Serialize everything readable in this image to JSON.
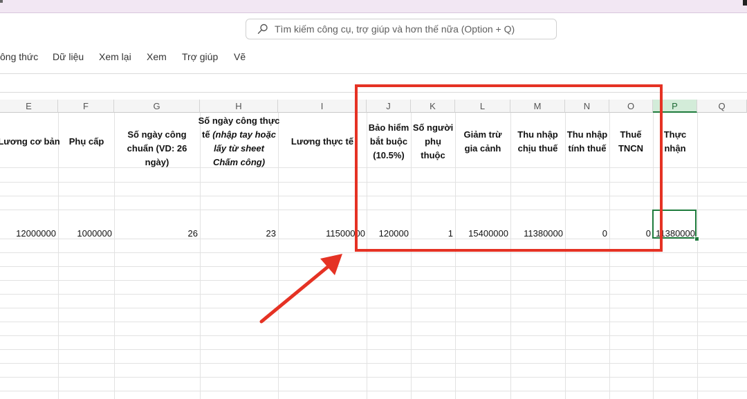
{
  "search": {
    "placeholder": "Tìm kiếm công cụ, trợ giúp và hơn thế nữa (Option + Q)",
    "icon": "search-icon"
  },
  "ribbon": {
    "tabs": [
      "ông thức",
      "Dữ liệu",
      "Xem lại",
      "Xem",
      "Trợ giúp",
      "Vẽ"
    ]
  },
  "columns": [
    "E",
    "F",
    "G",
    "H",
    "I",
    "J",
    "K",
    "L",
    "M",
    "N",
    "O",
    "P",
    "Q"
  ],
  "headers": {
    "E": "Lương cơ bản",
    "F": "Phụ cấp",
    "G": "Số ngày công chuẩn (VD: 26 ngày)",
    "H_line1": "Số ngày công thực",
    "H_line2_normal": "tế ",
    "H_line2_italic": "(nhập tay hoặc",
    "H_line3": "lấy từ sheet",
    "H_line4": "Chấm công)",
    "I": "Lương thực tế",
    "J": "Bảo hiểm bắt buộc (10.5%)",
    "K": "Số người phụ thuộc",
    "L": "Giảm trừ gia cảnh",
    "M": "Thu nhập chịu thuế",
    "N": "Thu nhập tính thuế",
    "O": "Thuế TNCN",
    "P": "Thực nhận"
  },
  "row": {
    "E": "12000000",
    "F": "1000000",
    "G": "26",
    "H": "23",
    "I": "11500000",
    "J": "120000",
    "K": "1",
    "L": "15400000",
    "M": "11380000",
    "N": "0",
    "O": "0",
    "P": "11380000"
  },
  "selected_column": "P",
  "annotation": {
    "highlight_color": "#e53224"
  }
}
